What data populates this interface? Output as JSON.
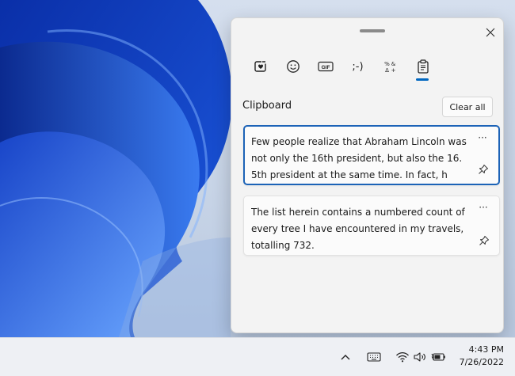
{
  "clipboard_panel": {
    "tabs": [
      {
        "icon": "heart-sticker-icon"
      },
      {
        "icon": "emoji-icon"
      },
      {
        "icon": "gif-icon",
        "label": "GIF"
      },
      {
        "icon": "kaomoji-icon",
        "label": ";-)"
      },
      {
        "icon": "symbols-icon"
      },
      {
        "icon": "clipboard-icon",
        "active": true
      }
    ],
    "title": "Clipboard",
    "clear_all_label": "Clear all",
    "items": [
      {
        "text": "Few people realize that Abraham Lincoln was not only the 16th president, but also the 16.5th president at the same time. In fact, h",
        "selected": true
      },
      {
        "text": "The list herein contains a numbered count of every tree I have encountered in my travels, totalling 732.",
        "selected": false
      }
    ],
    "more_label": "···"
  },
  "taskbar": {
    "time": "4:43 PM",
    "date": "7/26/2022"
  },
  "colors": {
    "accent": "#0067c0",
    "selected_border": "#1c63b7"
  }
}
